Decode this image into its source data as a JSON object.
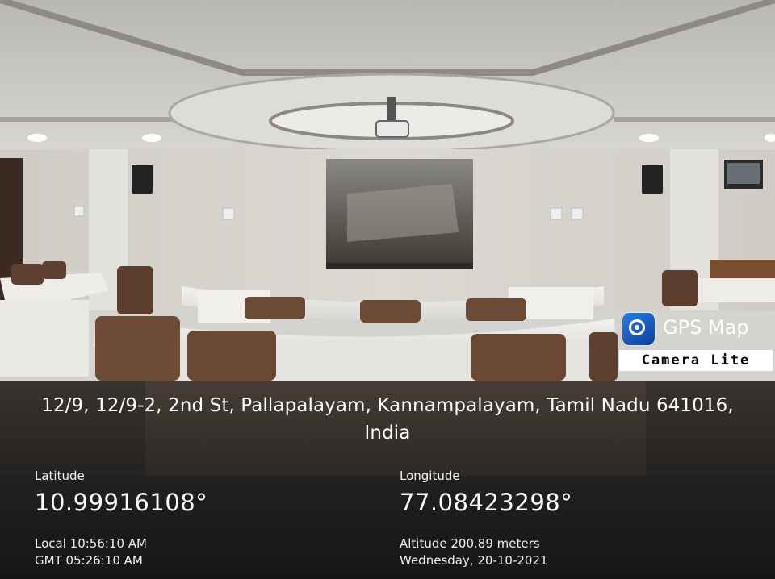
{
  "address": "12/9, 12/9-2, 2nd St, Pallapalayam, Kannampalayam, Tamil Nadu 641016, India",
  "latitude": {
    "label": "Latitude",
    "value": "10.99916108°"
  },
  "longitude": {
    "label": "Longitude",
    "value": "77.08423298°"
  },
  "local_time": "Local 10:56:10 AM",
  "gmt_time": "GMT 05:26:10 AM",
  "altitude": "Altitude 200.89 meters",
  "date": "Wednesday, 20-10-2021",
  "badge": {
    "title": "GPS Map",
    "subtitle": "Camera Lite"
  }
}
